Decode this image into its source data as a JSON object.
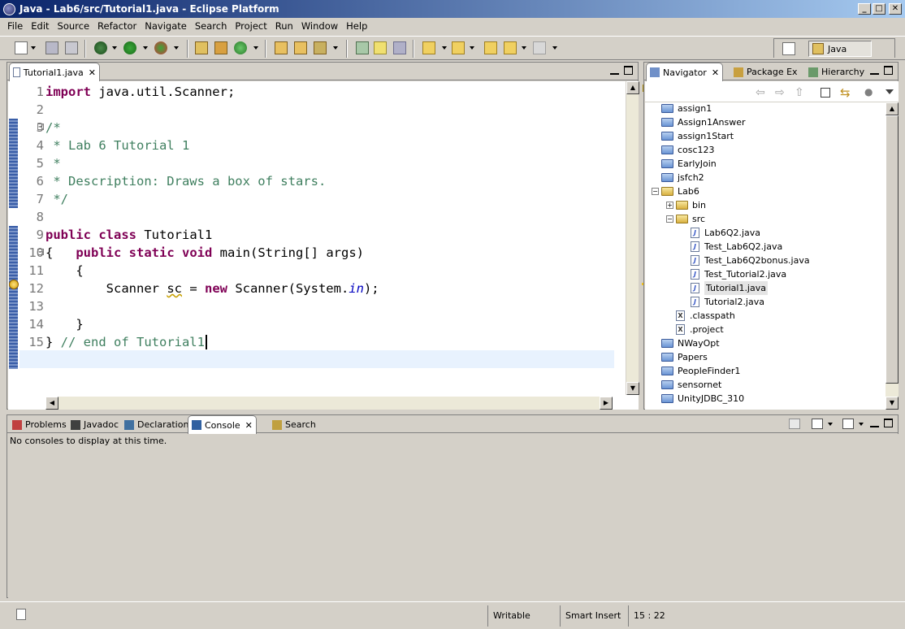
{
  "window": {
    "title": "Java - Lab6/src/Tutorial1.java - Eclipse Platform",
    "minimize": "_",
    "maximize": "□",
    "close": "✕"
  },
  "menu": [
    "File",
    "Edit",
    "Source",
    "Refactor",
    "Navigate",
    "Search",
    "Project",
    "Run",
    "Window",
    "Help"
  ],
  "perspective": {
    "label": "Java"
  },
  "editor": {
    "tab_label": "Tutorial1.java",
    "cursor_line": 15,
    "lines": [
      {
        "num": "1",
        "parts": [
          {
            "t": "import",
            "c": "kw"
          },
          {
            "t": " java.util.Scanner;",
            "c": ""
          }
        ]
      },
      {
        "num": "2",
        "parts": []
      },
      {
        "num": "3",
        "parts": [
          {
            "t": "/*",
            "c": "cm"
          }
        ]
      },
      {
        "num": "4",
        "parts": [
          {
            "t": " * Lab 6 Tutorial 1",
            "c": "cm"
          }
        ]
      },
      {
        "num": "5",
        "parts": [
          {
            "t": " *",
            "c": "cm"
          }
        ]
      },
      {
        "num": "6",
        "parts": [
          {
            "t": " * Description: Draws a box of stars.",
            "c": "cm"
          }
        ]
      },
      {
        "num": "7",
        "parts": [
          {
            "t": " */",
            "c": "cm"
          }
        ]
      },
      {
        "num": "8",
        "parts": []
      },
      {
        "num": "9",
        "parts": [
          {
            "t": "public",
            "c": "kw"
          },
          {
            "t": " ",
            "c": ""
          },
          {
            "t": "class",
            "c": "kw"
          },
          {
            "t": " Tutorial1",
            "c": ""
          }
        ]
      },
      {
        "num": "10",
        "parts": [
          {
            "t": "{   ",
            "c": ""
          },
          {
            "t": "public",
            "c": "kw"
          },
          {
            "t": " ",
            "c": ""
          },
          {
            "t": "static",
            "c": "kw"
          },
          {
            "t": " ",
            "c": ""
          },
          {
            "t": "void",
            "c": "kw"
          },
          {
            "t": " main(String[] args)",
            "c": ""
          }
        ]
      },
      {
        "num": "11",
        "parts": [
          {
            "t": "    {",
            "c": ""
          }
        ]
      },
      {
        "num": "12",
        "parts": [
          {
            "t": "        Scanner ",
            "c": ""
          },
          {
            "t": "sc",
            "c": "warn"
          },
          {
            "t": " = ",
            "c": ""
          },
          {
            "t": "new",
            "c": "kw"
          },
          {
            "t": " Scanner(System.",
            "c": ""
          },
          {
            "t": "in",
            "c": "it"
          },
          {
            "t": ");",
            "c": ""
          }
        ]
      },
      {
        "num": "13",
        "parts": []
      },
      {
        "num": "14",
        "parts": [
          {
            "t": "    }",
            "c": ""
          }
        ]
      },
      {
        "num": "15",
        "parts": [
          {
            "t": "} ",
            "c": ""
          },
          {
            "t": "// end of Tutorial1",
            "c": "cm"
          }
        ]
      }
    ]
  },
  "navigator": {
    "tabs": [
      {
        "label": "Navigator",
        "active": true
      },
      {
        "label": "Package Ex",
        "active": false
      },
      {
        "label": "Hierarchy",
        "active": false
      }
    ],
    "tree": [
      {
        "label": "assign1",
        "depth": 0,
        "type": "folder"
      },
      {
        "label": "Assign1Answer",
        "depth": 0,
        "type": "folder"
      },
      {
        "label": "assign1Start",
        "depth": 0,
        "type": "folder"
      },
      {
        "label": "cosc123",
        "depth": 0,
        "type": "folder"
      },
      {
        "label": "EarlyJoin",
        "depth": 0,
        "type": "folder"
      },
      {
        "label": "jsfch2",
        "depth": 0,
        "type": "folder"
      },
      {
        "label": "Lab6",
        "depth": 0,
        "type": "folder-open",
        "expander": "−"
      },
      {
        "label": "bin",
        "depth": 1,
        "type": "folder-open",
        "expander": "+"
      },
      {
        "label": "src",
        "depth": 1,
        "type": "folder-open",
        "expander": "−"
      },
      {
        "label": "Lab6Q2.java",
        "depth": 2,
        "type": "java"
      },
      {
        "label": "Test_Lab6Q2.java",
        "depth": 2,
        "type": "java"
      },
      {
        "label": "Test_Lab6Q2bonus.java",
        "depth": 2,
        "type": "java"
      },
      {
        "label": "Test_Tutorial2.java",
        "depth": 2,
        "type": "java"
      },
      {
        "label": "Tutorial1.java",
        "depth": 2,
        "type": "java",
        "selected": true
      },
      {
        "label": "Tutorial2.java",
        "depth": 2,
        "type": "java"
      },
      {
        "label": ".classpath",
        "depth": 1,
        "type": "xml"
      },
      {
        "label": ".project",
        "depth": 1,
        "type": "xml"
      },
      {
        "label": "NWayOpt",
        "depth": 0,
        "type": "folder"
      },
      {
        "label": "Papers",
        "depth": 0,
        "type": "folder"
      },
      {
        "label": "PeopleFinder1",
        "depth": 0,
        "type": "folder"
      },
      {
        "label": "sensornet",
        "depth": 0,
        "type": "folder"
      },
      {
        "label": "UnityJDBC_310",
        "depth": 0,
        "type": "folder"
      }
    ]
  },
  "bottom": {
    "tabs": [
      {
        "label": "Problems",
        "active": false
      },
      {
        "label": "Javadoc",
        "active": false
      },
      {
        "label": "Declaration",
        "active": false
      },
      {
        "label": "Console",
        "active": true
      },
      {
        "label": "Search",
        "active": false
      }
    ],
    "message": "No consoles to display at this time."
  },
  "status": {
    "writable": "Writable",
    "insert_mode": "Smart Insert",
    "position": "15 : 22"
  },
  "colors": {
    "keyword": "#7f0055",
    "comment": "#3f7f5f",
    "field": "#0000c0",
    "title_start": "#0a246a",
    "title_end": "#a6caf0"
  }
}
